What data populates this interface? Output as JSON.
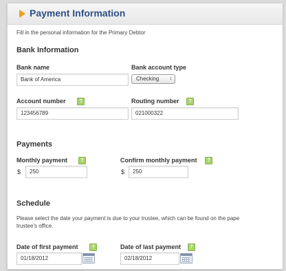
{
  "header": {
    "title": "Payment Information",
    "icon": "triangle-bullet-icon",
    "accent": "#f0a020"
  },
  "instructions": "Fill in the personal information for the Primary Debtor",
  "bank": {
    "heading": "Bank Information",
    "bank_name_label": "Bank name",
    "bank_name_value": "Bank of America",
    "account_type_label": "Bank account type",
    "account_type_value": "Checking",
    "account_number_label": "Account number",
    "account_number_value": "123456789",
    "routing_number_label": "Routing number",
    "routing_number_value": "021000322"
  },
  "payments": {
    "heading": "Payments",
    "monthly_label": "Monthly payment",
    "monthly_currency": "$",
    "monthly_value": "250",
    "confirm_label": "Confirm monthly payment",
    "confirm_currency": "$",
    "confirm_value": "250"
  },
  "schedule": {
    "heading": "Schedule",
    "text_line1": "Please select the date your payment is due to your trustee, which can be found on the pape",
    "text_line2": "trustee's office.",
    "first_label": "Date of first payment",
    "first_value": "01/18/2012",
    "last_label": "Date of last payment",
    "last_value": "02/18/2012"
  },
  "help_glyph": "?",
  "colors": {
    "title": "#2c4f86",
    "help": "#a9d36c"
  }
}
